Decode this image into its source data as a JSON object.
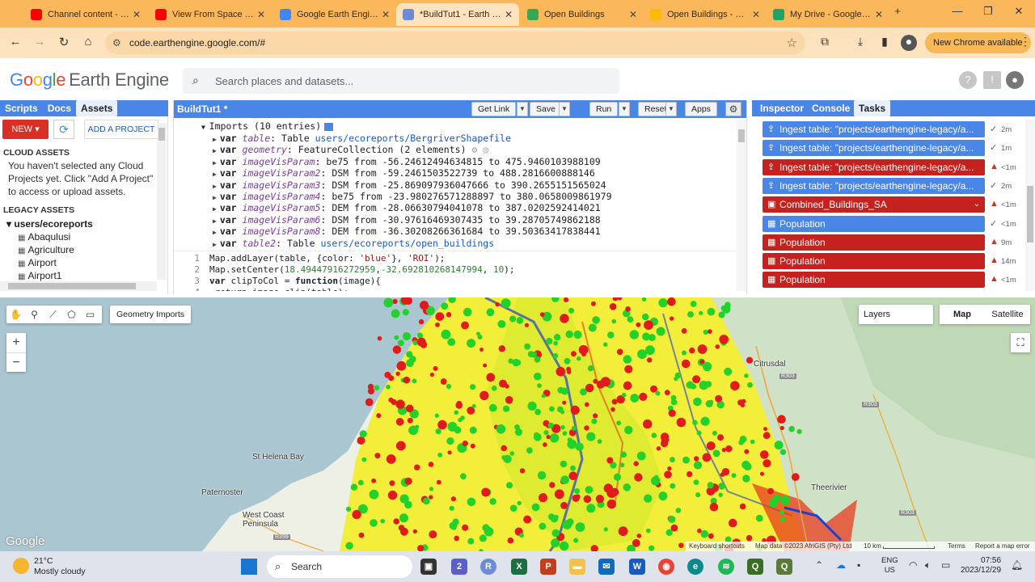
{
  "browser": {
    "tabs": [
      {
        "label": "Channel content - Yo",
        "color": "#ff0000"
      },
      {
        "label": "View From Space - Yo",
        "color": "#ff0000"
      },
      {
        "label": "Google Earth Engine",
        "color": "#4285f4"
      },
      {
        "label": "*BuildTut1 - Earth En",
        "color": "#6b8bd6"
      },
      {
        "label": "Open Buildings",
        "color": "#34a853"
      },
      {
        "label": "Open Buildings - doc",
        "color": "#fbbc05"
      },
      {
        "label": "My Drive - Google Dr",
        "color": "#1fa463"
      }
    ],
    "new_tab": "+",
    "url": "code.earthengine.google.com/#",
    "new_chrome": "New Chrome available"
  },
  "header": {
    "logo_google": [
      "G",
      "o",
      "o",
      "g",
      "l",
      "e"
    ],
    "logo_product": "Earth Engine",
    "search_placeholder": "Search places and datasets..."
  },
  "left_panel": {
    "tabs": [
      "Scripts",
      "Docs",
      "Assets"
    ],
    "selected_tab": "Assets",
    "new_label": "NEW",
    "add_project": "ADD A PROJECT",
    "cloud_heading": "CLOUD ASSETS",
    "cloud_message": "You haven't selected any Cloud Projects yet. Click \"Add A Project\" to access or upload assets.",
    "legacy_heading": "LEGACY ASSETS",
    "user_root": "users/ecoreports",
    "assets": [
      "Abaqulusi",
      "Agriculture",
      "Airport",
      "Airport1"
    ]
  },
  "editor": {
    "title": "BuildTut1 *",
    "buttons": {
      "get_link": "Get Link",
      "save": "Save",
      "run": "Run",
      "reset": "Reset",
      "apps": "Apps"
    },
    "imports_header": "Imports (10 entries)",
    "imports": [
      {
        "name": "table",
        "desc": "Table ",
        "link": "users/ecoreports/BergriverShapefile"
      },
      {
        "name": "geometry",
        "desc": "FeatureCollection (2 elements)",
        "link": ""
      },
      {
        "name": "imageVisParam",
        "desc": "be75 from -56.24612494634815 to 475.9460103988109",
        "link": ""
      },
      {
        "name": "imageVisParam2",
        "desc": "DSM from -59.2461503522739 to 488.2816600888146",
        "link": ""
      },
      {
        "name": "imageVisParam3",
        "desc": "DSM from -25.869097936047666 to 390.2655151565024",
        "link": ""
      },
      {
        "name": "imageVisParam4",
        "desc": "be75 from -23.980276571288897 to 380.0658009861979",
        "link": ""
      },
      {
        "name": "imageVisParam5",
        "desc": "DEM from -28.06630794041078 to 387.0202592414021",
        "link": ""
      },
      {
        "name": "imageVisParam6",
        "desc": "DSM from -30.97616469307435 to 39.28705749862188",
        "link": ""
      },
      {
        "name": "imageVisParam8",
        "desc": "DEM from -36.30208266361684 to 39.50363417838441",
        "link": ""
      },
      {
        "name": "table2",
        "desc": "Table ",
        "link": "users/ecoreports/open_buildings"
      }
    ],
    "code": [
      {
        "n": "1",
        "parts": [
          [
            "",
            "Map.addLayer(table, {color: "
          ],
          [
            "str",
            "'blue'"
          ],
          [
            "",
            "}, "
          ],
          [
            "str",
            "'ROI'"
          ],
          [
            "",
            ");"
          ]
        ]
      },
      {
        "n": "2",
        "parts": [
          [
            "",
            "Map.setCenter("
          ],
          [
            "num",
            "18.49447916272959"
          ],
          [
            "",
            ","
          ],
          [
            "num",
            "-32.692810268147994"
          ],
          [
            "",
            ", "
          ],
          [
            "num",
            "10"
          ],
          [
            "",
            ");"
          ]
        ]
      },
      {
        "n": "3",
        "parts": [
          [
            "fn",
            "var"
          ],
          [
            "",
            " clipToCol = "
          ],
          [
            "fn",
            "function"
          ],
          [
            "",
            "(image){"
          ]
        ]
      },
      {
        "n": "4",
        "parts": [
          [
            "",
            "  return image.clip(table);"
          ]
        ]
      }
    ]
  },
  "right_panel": {
    "tabs": [
      "Inspector",
      "Console",
      "Tasks"
    ],
    "selected_tab": "Tasks",
    "tasks": [
      {
        "label": "Ingest table: \"projects/earthengine-legacy/a...",
        "status": "ok",
        "time": "2m",
        "color": "blue",
        "icon": "upload"
      },
      {
        "label": "Ingest table: \"projects/earthengine-legacy/a...",
        "status": "ok",
        "time": "1m",
        "color": "blue",
        "icon": "upload"
      },
      {
        "label": "Ingest table: \"projects/earthengine-legacy/a...",
        "status": "err",
        "time": "<1m",
        "color": "red",
        "icon": "upload"
      },
      {
        "label": "Ingest table: \"projects/earthengine-legacy/a...",
        "status": "ok",
        "time": "2m",
        "color": "blue",
        "icon": "upload"
      },
      {
        "label": "Combined_Buildings_SA",
        "status": "err",
        "time": "<1m",
        "color": "red",
        "icon": "image"
      },
      {
        "label": "Population",
        "status": "ok",
        "time": "<1m",
        "color": "blue",
        "icon": "table"
      },
      {
        "label": "Population",
        "status": "err",
        "time": "9m",
        "color": "red",
        "icon": "table"
      },
      {
        "label": "Population",
        "status": "err",
        "time": "14m",
        "color": "red",
        "icon": "table"
      },
      {
        "label": "Population",
        "status": "err",
        "time": "<1m",
        "color": "red",
        "icon": "table"
      }
    ]
  },
  "map": {
    "geometry_imports": "Geometry Imports",
    "layers": "Layers",
    "map_types": [
      "Map",
      "Satellite"
    ],
    "selected_type": "Map",
    "zoom_in": "+",
    "zoom_out": "−",
    "places": [
      "Citrusdal",
      "St Helena Bay",
      "Paternoster",
      "West Coast Peninsula",
      "Theerivier"
    ],
    "roads": [
      "R303",
      "R303",
      "R303",
      "R399"
    ],
    "watermark": "Google",
    "footer": {
      "shortcuts": "Keyboard shortcuts",
      "mapdata": "Map data ©2023 AfriGIS (Pty) Ltd",
      "scale": "10 km",
      "terms": "Terms",
      "report": "Report a map error"
    }
  },
  "taskbar": {
    "temp": "21°C",
    "weather": "Mostly cloudy",
    "search": "Search",
    "lang1": "ENG",
    "lang2": "US",
    "time": "07:56",
    "date": "2023/12/29",
    "badge": "2"
  }
}
